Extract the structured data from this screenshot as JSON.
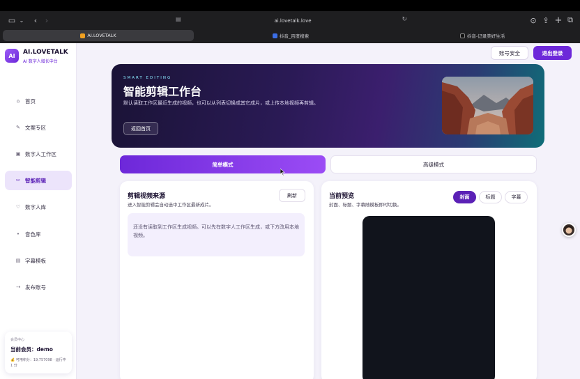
{
  "browser": {
    "url": "ai.lovetalk.love",
    "tabs": [
      {
        "label": "AI.LOVETALK",
        "active": true,
        "fav_color": "#f0a020"
      },
      {
        "label": "抖音_百度搜索",
        "active": false,
        "fav_color": "#3b6ee6"
      },
      {
        "label": "抖音-记录美好生活",
        "active": false,
        "fav_color": "#111111"
      }
    ]
  },
  "brand": {
    "badge": "AI",
    "name": "AI.LOVETALK",
    "tagline": "AI 数字人增长中台"
  },
  "sidebar": {
    "items": [
      {
        "label": "首页",
        "icon": "home-icon",
        "glyph": "⌂",
        "active": false
      },
      {
        "label": "文案专区",
        "icon": "pen-icon",
        "glyph": "✎",
        "active": false
      },
      {
        "label": "数字人工作区",
        "icon": "grid-icon",
        "glyph": "▣",
        "active": false
      },
      {
        "label": "智能剪辑",
        "icon": "scissors-icon",
        "glyph": "✂",
        "active": true
      },
      {
        "label": "数字人库",
        "icon": "heart-icon",
        "glyph": "♡",
        "active": false
      },
      {
        "label": "音色库",
        "icon": "dot-icon",
        "glyph": "•",
        "active": false
      },
      {
        "label": "字幕模板",
        "icon": "list-icon",
        "glyph": "▤",
        "active": false
      },
      {
        "label": "发布账号",
        "icon": "send-icon",
        "glyph": "⇢",
        "active": false
      }
    ]
  },
  "member": {
    "caption": "会员中心",
    "name": "当前会员：demo",
    "points": "💰 可用积分：19,757098 · 运行中 1 分"
  },
  "header": {
    "security_label": "账号安全",
    "logout_label": "退出登录"
  },
  "hero": {
    "kicker": "SMART EDITING",
    "title": "智能剪辑工作台",
    "desc": "默认读取工作区最近生成的视频，也可以从列表切换成其它成片，或上传本地视频再剪辑。",
    "home_label": "返回首页"
  },
  "modes": {
    "simple": "简单模式",
    "advanced": "高级模式"
  },
  "source": {
    "title": "剪辑视频来源",
    "subtitle": "进入智能剪辑会自动选中工作区最新成片。",
    "refresh_label": "刷新",
    "empty_text": "还没有读取到工作区生成视频。可以先在数字人工作区生成，或下方改用本地视频。"
  },
  "preview": {
    "title": "当前预览",
    "subtitle": "封面、标题、字幕随模板即时切换。",
    "segments": [
      {
        "label": "封面",
        "active": true
      },
      {
        "label": "标题",
        "active": false
      },
      {
        "label": "字幕",
        "active": false
      }
    ]
  }
}
